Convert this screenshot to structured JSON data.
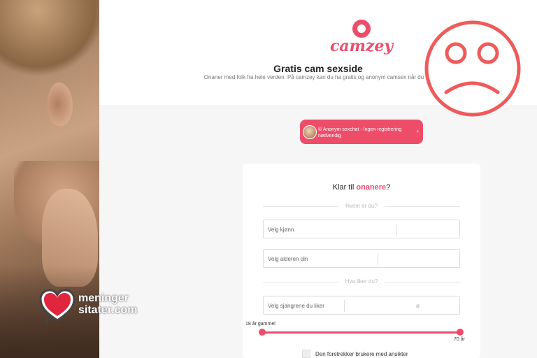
{
  "brand": {
    "name": "camzey",
    "color": "#ee4d6a"
  },
  "hero": {
    "headline": "Gratis cam sexside",
    "subline": "Onaner med folk fra hele verden. På camzey kan du ha gratis og anonym camsex når du vil."
  },
  "promo": {
    "text": "© Anonym sexchat - Ingen registrering nødvendig",
    "chevron": "›"
  },
  "form": {
    "title_prefix": "Klar til ",
    "title_accent": "onanere",
    "title_suffix": "?",
    "section_who": "Hvem er du?",
    "gender_placeholder": "Velg kjønn",
    "age_placeholder": "Velg alderen din",
    "section_likes": "Hva liker du?",
    "genre_placeholder": "Velg sjangrene du liker",
    "genre_symbol": "ø",
    "age_min_label": "18 år gammel",
    "age_max_label": "70 år",
    "age_min": 18,
    "age_max": 70,
    "face_checkbox_label": "Den foretrekker brukere med ansikter"
  },
  "watermark": {
    "line1": "meninger",
    "line2": "sitater.com"
  },
  "overlay": {
    "icon": "sad-face-icon",
    "color": "#f05a5a"
  }
}
